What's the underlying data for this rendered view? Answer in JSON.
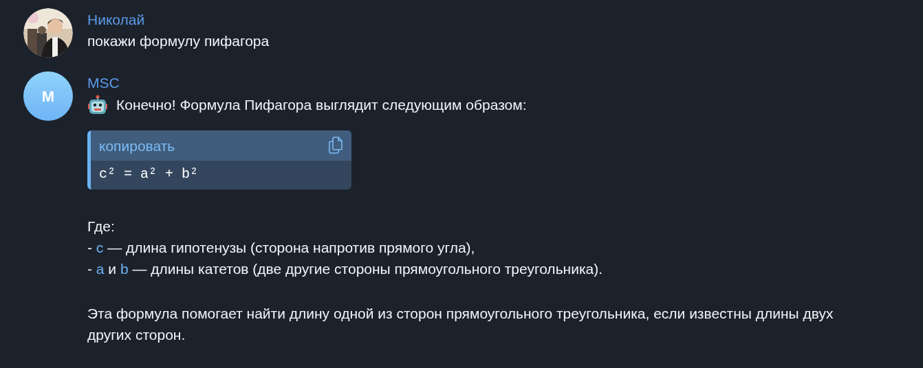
{
  "messages": [
    {
      "sender": "Николай",
      "text": "покажи формулу пифагора"
    },
    {
      "sender": "MSC",
      "avatar": {
        "kind": "initial",
        "letter": "M"
      },
      "intro": "Конечно! Формула Пифагора выглядит следующим образом:",
      "code_block": {
        "copy_label": "копировать",
        "code": "c² = a² + b²"
      },
      "heading": "Где:",
      "list_lines": [
        [
          {
            "text": "- "
          },
          {
            "text": "c",
            "kind": "code"
          },
          {
            "text": " — длина гипотенузы (сторона напротив прямого угла),"
          }
        ],
        [
          {
            "text": "- "
          },
          {
            "text": "a",
            "kind": "code"
          },
          {
            "text": " и "
          },
          {
            "text": "b",
            "kind": "code"
          },
          {
            "text": " — длины катетов (две другие стороны прямоугольного треугольника)."
          }
        ]
      ],
      "paragraph": "Эта формула помогает найти длину одной из сторон прямоугольного треугольника, если известны длины двух других сторон."
    }
  ]
}
